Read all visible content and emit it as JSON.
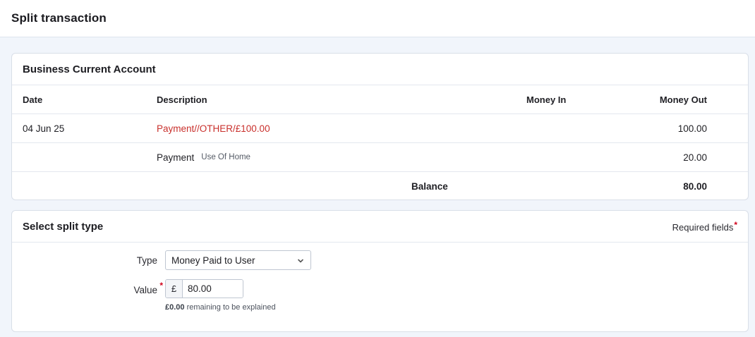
{
  "page": {
    "title": "Split transaction"
  },
  "account": {
    "title": "Business Current Account",
    "headers": {
      "date": "Date",
      "description": "Description",
      "money_in": "Money In",
      "money_out": "Money Out"
    },
    "rows": [
      {
        "date": "04 Jun 25",
        "description": "Payment//OTHER/£100.00",
        "money_in": "",
        "money_out": "100.00"
      },
      {
        "date": "",
        "description": "Payment",
        "sub": "Use Of Home",
        "money_in": "",
        "money_out": "20.00"
      }
    ],
    "balance": {
      "label": "Balance",
      "value": "80.00"
    }
  },
  "split": {
    "title": "Select split type",
    "required_label": "Required fields",
    "required_marker": "*",
    "type_label": "Type",
    "type_value": "Money Paid to User",
    "value_label": "Value",
    "currency": "£",
    "amount": "80.00",
    "remaining_amount": "£0.00",
    "remaining_text": "remaining to be explained"
  },
  "colors": {
    "accent_red": "#c9302c",
    "required_red": "#d0021b",
    "page_bg": "#f1f5fb"
  },
  "icons": {
    "select": "chevron-down-icon"
  }
}
